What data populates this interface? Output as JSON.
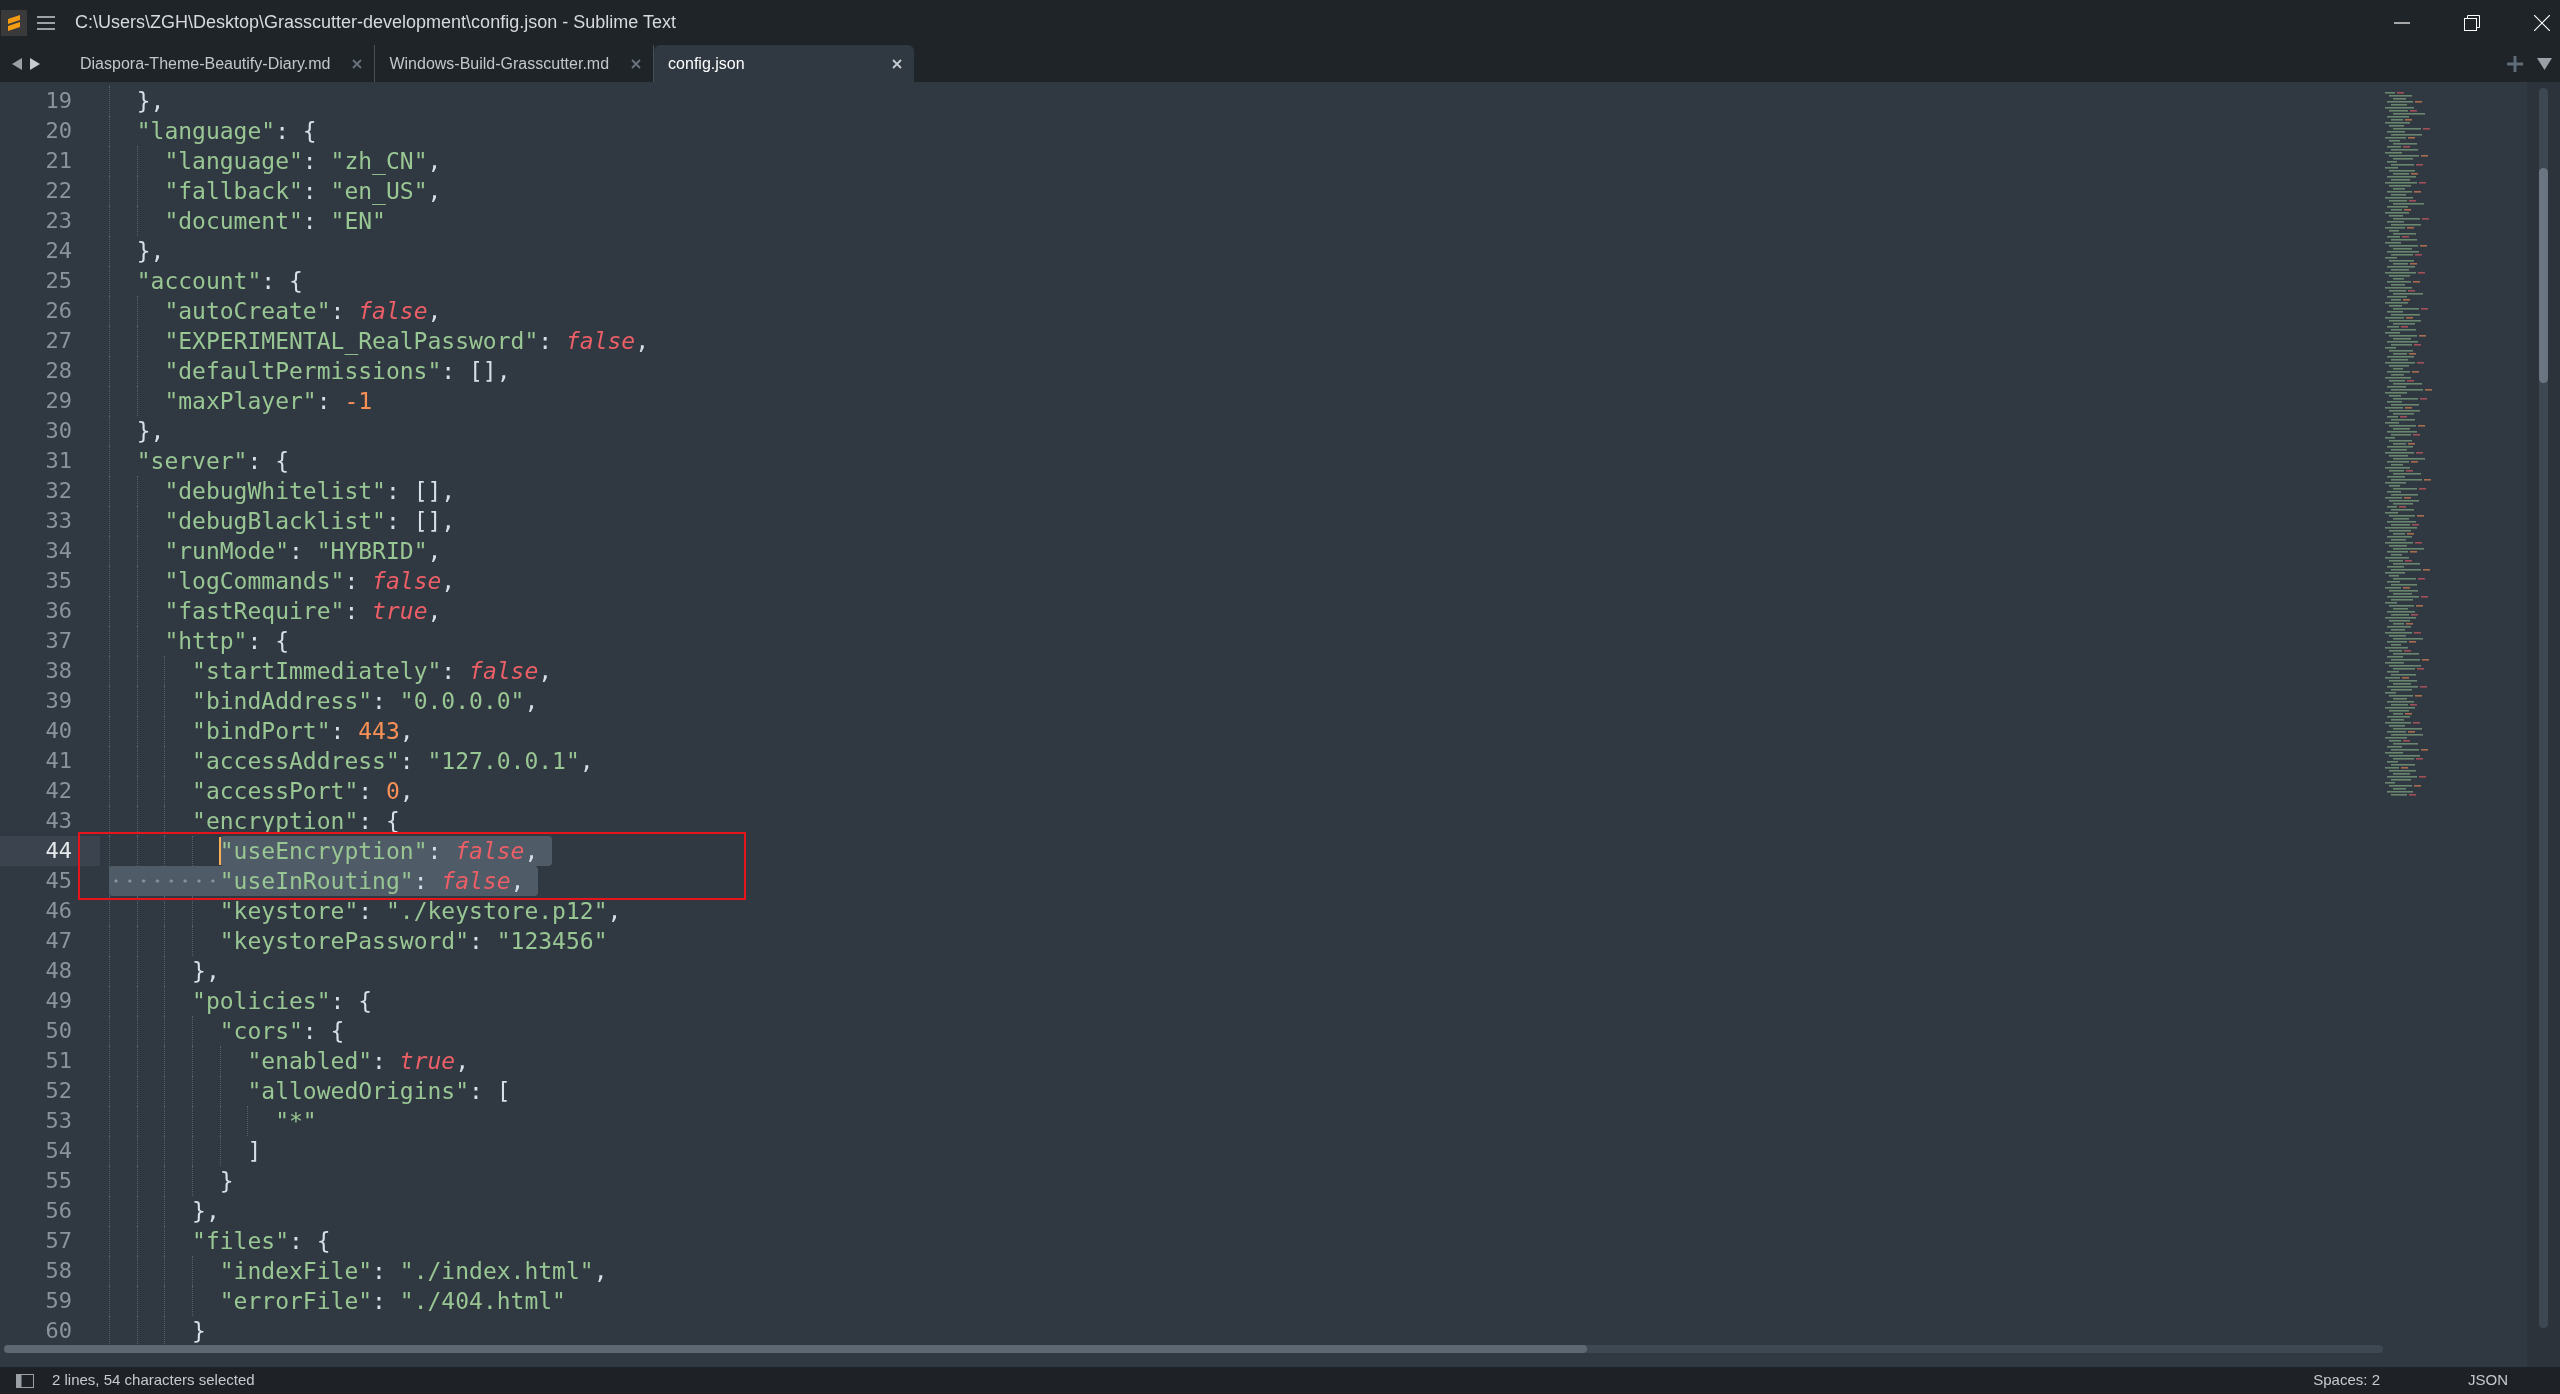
{
  "window": {
    "title": "C:\\Users\\ZGH\\Desktop\\Grasscutter-development\\config.json - Sublime Text"
  },
  "tabs": [
    {
      "label": "Diaspora-Theme-Beautify-Diary.md",
      "selected": false
    },
    {
      "label": "Windows-Build-Grasscutter.md",
      "selected": false
    },
    {
      "label": "config.json",
      "selected": true
    }
  ],
  "lines": [
    {
      "number": "19",
      "selected": false,
      "caret": false,
      "marked": false,
      "tokens": [
        {
          "kind": "punct",
          "text": "  },"
        }
      ]
    },
    {
      "number": "20",
      "selected": false,
      "caret": false,
      "marked": false,
      "tokens": [
        {
          "kind": "string",
          "text": "  \"language\""
        },
        {
          "kind": "punct",
          "text": ": {"
        }
      ]
    },
    {
      "number": "21",
      "selected": false,
      "caret": false,
      "marked": false,
      "tokens": [
        {
          "kind": "string",
          "text": "    \"language\""
        },
        {
          "kind": "punct",
          "text": ": "
        },
        {
          "kind": "string",
          "text": "\"zh_CN\""
        },
        {
          "kind": "punct",
          "text": ","
        }
      ]
    },
    {
      "number": "22",
      "selected": false,
      "caret": false,
      "marked": false,
      "tokens": [
        {
          "kind": "string",
          "text": "    \"fallback\""
        },
        {
          "kind": "punct",
          "text": ": "
        },
        {
          "kind": "string",
          "text": "\"en_US\""
        },
        {
          "kind": "punct",
          "text": ","
        }
      ]
    },
    {
      "number": "23",
      "selected": false,
      "caret": false,
      "marked": false,
      "tokens": [
        {
          "kind": "string",
          "text": "    \"document\""
        },
        {
          "kind": "punct",
          "text": ": "
        },
        {
          "kind": "string",
          "text": "\"EN\""
        }
      ]
    },
    {
      "number": "24",
      "selected": false,
      "caret": false,
      "marked": false,
      "tokens": [
        {
          "kind": "punct",
          "text": "  },"
        }
      ]
    },
    {
      "number": "25",
      "selected": false,
      "caret": false,
      "marked": false,
      "tokens": [
        {
          "kind": "string",
          "text": "  \"account\""
        },
        {
          "kind": "punct",
          "text": ": {"
        }
      ]
    },
    {
      "number": "26",
      "selected": false,
      "caret": false,
      "marked": false,
      "tokens": [
        {
          "kind": "string",
          "text": "    \"autoCreate\""
        },
        {
          "kind": "punct",
          "text": ": "
        },
        {
          "kind": "bool",
          "text": "false"
        },
        {
          "kind": "punct",
          "text": ","
        }
      ]
    },
    {
      "number": "27",
      "selected": false,
      "caret": false,
      "marked": false,
      "tokens": [
        {
          "kind": "string",
          "text": "    \"EXPERIMENTAL_RealPassword\""
        },
        {
          "kind": "punct",
          "text": ": "
        },
        {
          "kind": "bool",
          "text": "false"
        },
        {
          "kind": "punct",
          "text": ","
        }
      ]
    },
    {
      "number": "28",
      "selected": false,
      "caret": false,
      "marked": false,
      "tokens": [
        {
          "kind": "string",
          "text": "    \"defaultPermissions\""
        },
        {
          "kind": "punct",
          "text": ": [],"
        }
      ]
    },
    {
      "number": "29",
      "selected": false,
      "caret": false,
      "marked": false,
      "tokens": [
        {
          "kind": "string",
          "text": "    \"maxPlayer\""
        },
        {
          "kind": "punct",
          "text": ": "
        },
        {
          "kind": "number",
          "text": "-1"
        }
      ]
    },
    {
      "number": "30",
      "selected": false,
      "caret": false,
      "marked": false,
      "tokens": [
        {
          "kind": "punct",
          "text": "  },"
        }
      ]
    },
    {
      "number": "31",
      "selected": false,
      "caret": false,
      "marked": false,
      "tokens": [
        {
          "kind": "string",
          "text": "  \"server\""
        },
        {
          "kind": "punct",
          "text": ": {"
        }
      ]
    },
    {
      "number": "32",
      "selected": false,
      "caret": false,
      "marked": false,
      "tokens": [
        {
          "kind": "string",
          "text": "    \"debugWhitelist\""
        },
        {
          "kind": "punct",
          "text": ": [],"
        }
      ]
    },
    {
      "number": "33",
      "selected": false,
      "caret": false,
      "marked": false,
      "tokens": [
        {
          "kind": "string",
          "text": "    \"debugBlacklist\""
        },
        {
          "kind": "punct",
          "text": ": [],"
        }
      ]
    },
    {
      "number": "34",
      "selected": false,
      "caret": false,
      "marked": false,
      "tokens": [
        {
          "kind": "string",
          "text": "    \"runMode\""
        },
        {
          "kind": "punct",
          "text": ": "
        },
        {
          "kind": "string",
          "text": "\"HYBRID\""
        },
        {
          "kind": "punct",
          "text": ","
        }
      ]
    },
    {
      "number": "35",
      "selected": false,
      "caret": false,
      "marked": false,
      "tokens": [
        {
          "kind": "string",
          "text": "    \"logCommands\""
        },
        {
          "kind": "punct",
          "text": ": "
        },
        {
          "kind": "bool",
          "text": "false"
        },
        {
          "kind": "punct",
          "text": ","
        }
      ]
    },
    {
      "number": "36",
      "selected": false,
      "caret": false,
      "marked": false,
      "tokens": [
        {
          "kind": "string",
          "text": "    \"fastRequire\""
        },
        {
          "kind": "punct",
          "text": ": "
        },
        {
          "kind": "bool",
          "text": "true"
        },
        {
          "kind": "punct",
          "text": ","
        }
      ]
    },
    {
      "number": "37",
      "selected": false,
      "caret": false,
      "marked": false,
      "tokens": [
        {
          "kind": "string",
          "text": "    \"http\""
        },
        {
          "kind": "punct",
          "text": ": {"
        }
      ]
    },
    {
      "number": "38",
      "selected": false,
      "caret": false,
      "marked": false,
      "tokens": [
        {
          "kind": "string",
          "text": "      \"startImmediately\""
        },
        {
          "kind": "punct",
          "text": ": "
        },
        {
          "kind": "bool",
          "text": "false"
        },
        {
          "kind": "punct",
          "text": ","
        }
      ]
    },
    {
      "number": "39",
      "selected": false,
      "caret": false,
      "marked": false,
      "tokens": [
        {
          "kind": "string",
          "text": "      \"bindAddress\""
        },
        {
          "kind": "punct",
          "text": ": "
        },
        {
          "kind": "string",
          "text": "\"0.0.0.0\""
        },
        {
          "kind": "punct",
          "text": ","
        }
      ]
    },
    {
      "number": "40",
      "selected": false,
      "caret": false,
      "marked": false,
      "tokens": [
        {
          "kind": "string",
          "text": "      \"bindPort\""
        },
        {
          "kind": "punct",
          "text": ": "
        },
        {
          "kind": "number",
          "text": "443"
        },
        {
          "kind": "punct",
          "text": ","
        }
      ]
    },
    {
      "number": "41",
      "selected": false,
      "caret": false,
      "marked": false,
      "tokens": [
        {
          "kind": "string",
          "text": "      \"accessAddress\""
        },
        {
          "kind": "punct",
          "text": ": "
        },
        {
          "kind": "string",
          "text": "\"127.0.0.1\""
        },
        {
          "kind": "punct",
          "text": ","
        }
      ]
    },
    {
      "number": "42",
      "selected": false,
      "caret": false,
      "marked": false,
      "tokens": [
        {
          "kind": "string",
          "text": "      \"accessPort\""
        },
        {
          "kind": "punct",
          "text": ": "
        },
        {
          "kind": "number",
          "text": "0"
        },
        {
          "kind": "punct",
          "text": ","
        }
      ]
    },
    {
      "number": "43",
      "selected": false,
      "caret": false,
      "marked": false,
      "tokens": [
        {
          "kind": "string",
          "text": "      \"encryption\""
        },
        {
          "kind": "punct",
          "text": ": {"
        }
      ]
    },
    {
      "number": "44",
      "selected": true,
      "caret": true,
      "marked": true,
      "tokens": [
        {
          "kind": "string",
          "text": "        \"useEncryption\""
        },
        {
          "kind": "punct",
          "text": ": "
        },
        {
          "kind": "bool",
          "text": "false"
        },
        {
          "kind": "punct",
          "text": ","
        }
      ]
    },
    {
      "number": "45",
      "selected": true,
      "caret": false,
      "marked": true,
      "tokens": [
        {
          "kind": "string",
          "text": "        \"useInRouting\""
        },
        {
          "kind": "punct",
          "text": ": "
        },
        {
          "kind": "bool",
          "text": "false"
        },
        {
          "kind": "punct",
          "text": ","
        }
      ]
    },
    {
      "number": "46",
      "selected": false,
      "caret": false,
      "marked": false,
      "tokens": [
        {
          "kind": "string",
          "text": "        \"keystore\""
        },
        {
          "kind": "punct",
          "text": ": "
        },
        {
          "kind": "string",
          "text": "\"./keystore.p12\""
        },
        {
          "kind": "punct",
          "text": ","
        }
      ]
    },
    {
      "number": "47",
      "selected": false,
      "caret": false,
      "marked": false,
      "tokens": [
        {
          "kind": "string",
          "text": "        \"keystorePassword\""
        },
        {
          "kind": "punct",
          "text": ": "
        },
        {
          "kind": "string",
          "text": "\"123456\""
        }
      ]
    },
    {
      "number": "48",
      "selected": false,
      "caret": false,
      "marked": false,
      "tokens": [
        {
          "kind": "punct",
          "text": "      },"
        }
      ]
    },
    {
      "number": "49",
      "selected": false,
      "caret": false,
      "marked": false,
      "tokens": [
        {
          "kind": "string",
          "text": "      \"policies\""
        },
        {
          "kind": "punct",
          "text": ": {"
        }
      ]
    },
    {
      "number": "50",
      "selected": false,
      "caret": false,
      "marked": false,
      "tokens": [
        {
          "kind": "string",
          "text": "        \"cors\""
        },
        {
          "kind": "punct",
          "text": ": {"
        }
      ]
    },
    {
      "number": "51",
      "selected": false,
      "caret": false,
      "marked": false,
      "tokens": [
        {
          "kind": "string",
          "text": "          \"enabled\""
        },
        {
          "kind": "punct",
          "text": ": "
        },
        {
          "kind": "bool",
          "text": "true"
        },
        {
          "kind": "punct",
          "text": ","
        }
      ]
    },
    {
      "number": "52",
      "selected": false,
      "caret": false,
      "marked": false,
      "tokens": [
        {
          "kind": "string",
          "text": "          \"allowedOrigins\""
        },
        {
          "kind": "punct",
          "text": ": ["
        }
      ]
    },
    {
      "number": "53",
      "selected": false,
      "caret": false,
      "marked": false,
      "tokens": [
        {
          "kind": "string",
          "text": "            \"*\""
        }
      ]
    },
    {
      "number": "54",
      "selected": false,
      "caret": false,
      "marked": false,
      "tokens": [
        {
          "kind": "punct",
          "text": "          ]"
        }
      ]
    },
    {
      "number": "55",
      "selected": false,
      "caret": false,
      "marked": false,
      "tokens": [
        {
          "kind": "punct",
          "text": "        }"
        }
      ]
    },
    {
      "number": "56",
      "selected": false,
      "caret": false,
      "marked": false,
      "tokens": [
        {
          "kind": "punct",
          "text": "      },"
        }
      ]
    },
    {
      "number": "57",
      "selected": false,
      "caret": false,
      "marked": false,
      "tokens": [
        {
          "kind": "string",
          "text": "      \"files\""
        },
        {
          "kind": "punct",
          "text": ": {"
        }
      ]
    },
    {
      "number": "58",
      "selected": false,
      "caret": false,
      "marked": false,
      "tokens": [
        {
          "kind": "string",
          "text": "        \"indexFile\""
        },
        {
          "kind": "punct",
          "text": ": "
        },
        {
          "kind": "string",
          "text": "\"./index.html\""
        },
        {
          "kind": "punct",
          "text": ","
        }
      ]
    },
    {
      "number": "59",
      "selected": false,
      "caret": false,
      "marked": false,
      "tokens": [
        {
          "kind": "string",
          "text": "        \"errorFile\""
        },
        {
          "kind": "punct",
          "text": ": "
        },
        {
          "kind": "string",
          "text": "\"./404.html\""
        }
      ]
    },
    {
      "number": "60",
      "selected": false,
      "caret": false,
      "marked": false,
      "tokens": [
        {
          "kind": "punct",
          "text": "      }"
        }
      ]
    }
  ],
  "status_bar": {
    "selection": "2 lines, 54 characters selected",
    "indentation": "Spaces: 2",
    "syntax": "JSON"
  }
}
